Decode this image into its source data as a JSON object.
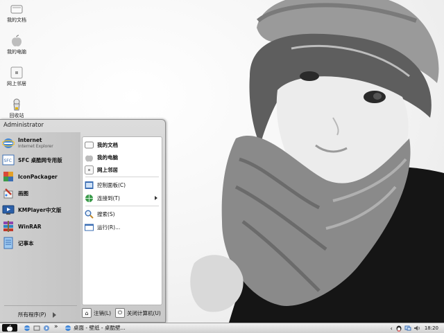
{
  "desktop_icons": [
    {
      "label": "我的文档",
      "icon": "documents-icon"
    },
    {
      "label": "我的电脑",
      "icon": "computer-icon"
    },
    {
      "label": "网上邻居",
      "icon": "network-icon"
    },
    {
      "label": "回收站",
      "icon": "recycle-bin-icon"
    }
  ],
  "start_menu": {
    "user_name": "Administrator",
    "programs": [
      {
        "name": "Internet",
        "sub": "Internet Explorer",
        "icon": "internet-explorer-icon"
      },
      {
        "name": "SFC 桌酷网专用版",
        "icon": "sfc-icon"
      },
      {
        "name": "IconPackager",
        "icon": "iconpackager-icon"
      },
      {
        "name": "画图",
        "icon": "paint-icon"
      },
      {
        "name": "KMPlayer中文版",
        "icon": "kmplayer-icon"
      },
      {
        "name": "WinRAR",
        "icon": "winrar-icon"
      },
      {
        "name": "记事本",
        "icon": "notepad-icon"
      }
    ],
    "all_programs": "所有程序(P)",
    "places": [
      {
        "label": "我的文档",
        "icon": "documents-icon"
      },
      {
        "label": "我的电脑",
        "icon": "computer-icon"
      },
      {
        "label": "网上邻居",
        "icon": "network-icon"
      },
      {
        "label": "控制面板(C)",
        "icon": "control-panel-icon"
      },
      {
        "label": "连接到(T)",
        "icon": "connect-icon"
      },
      {
        "label": "搜索(S)",
        "icon": "search-icon"
      },
      {
        "label": "运行(R)...",
        "icon": "run-icon"
      }
    ],
    "logoff_label": "注销(L)",
    "shutdown_label": "关闭计算机(U)"
  },
  "taskbar": {
    "task_label": "桌面 - 壁纸 - 桌酷壁...",
    "clock": "18:20",
    "quick_launch_more": "»"
  }
}
